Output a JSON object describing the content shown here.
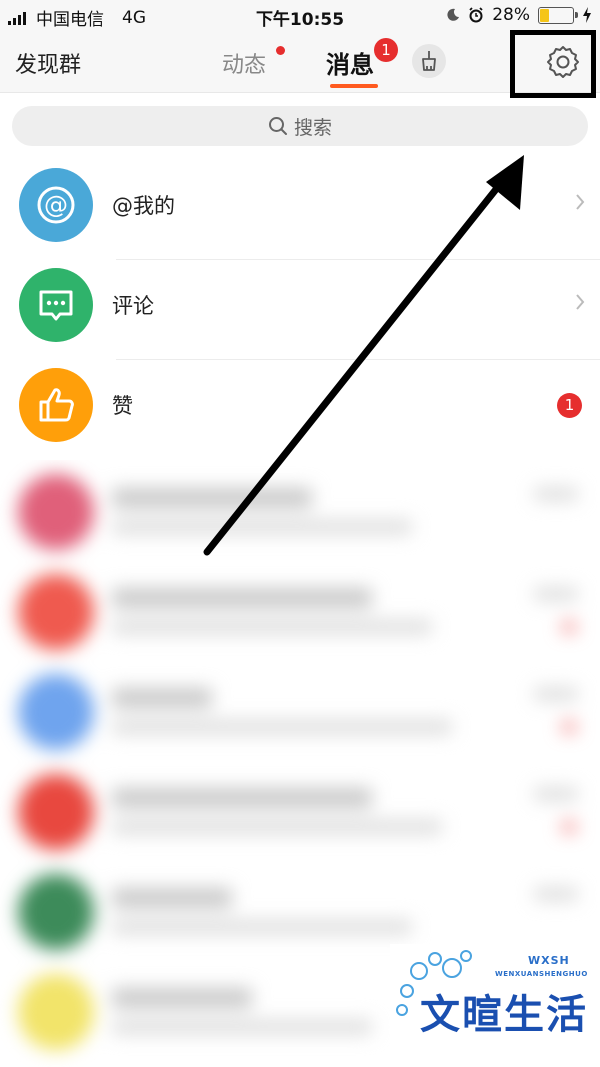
{
  "status_bar": {
    "carrier": "中国电信",
    "network": "4G",
    "time": "下午10:55",
    "battery_percent": "28%",
    "battery_level": 0.28
  },
  "nav": {
    "left_label": "发现群",
    "tabs": [
      {
        "label": "动态",
        "has_dot": true
      },
      {
        "label": "消息",
        "badge": "1",
        "active": true
      }
    ],
    "icons": [
      "broom-icon",
      "gear-icon"
    ]
  },
  "search": {
    "placeholder": "搜索"
  },
  "message_categories": [
    {
      "label": "@我的",
      "icon": "at-icon",
      "color": "#4aa8d8",
      "has_chevron": true
    },
    {
      "label": "评论",
      "icon": "comment-icon",
      "color": "#2fb36b",
      "has_chevron": true
    },
    {
      "label": "赞",
      "icon": "thumbs-up-icon",
      "color": "#ff9f0a",
      "badge": "1"
    }
  ],
  "watermark": {
    "small": "WXSH",
    "subtitle": "WENXUANSHENGHUO",
    "main": "文暄生活"
  },
  "colors": {
    "accent": "#ff5a1f",
    "badge_red": "#e62e2e"
  }
}
